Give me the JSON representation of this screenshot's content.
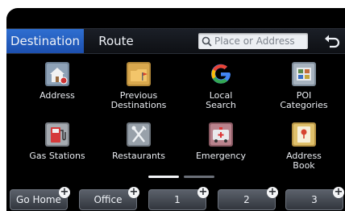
{
  "tabs": [
    {
      "label": "Destination",
      "active": true
    },
    {
      "label": "Route",
      "active": false
    }
  ],
  "search": {
    "placeholder": "Place or Address"
  },
  "grid": [
    {
      "label": "Address",
      "icon": "house-icon"
    },
    {
      "label": "Previous\nDestinations",
      "icon": "folder-flag-icon"
    },
    {
      "label": "Local\nSearch",
      "icon": "google-g-icon"
    },
    {
      "label": "POI\nCategories",
      "icon": "poi-map-icon"
    },
    {
      "label": "Gas Stations",
      "icon": "gas-pump-icon"
    },
    {
      "label": "Restaurants",
      "icon": "fork-knife-icon"
    },
    {
      "label": "Emergency",
      "icon": "ambulance-icon"
    },
    {
      "label": "Address\nBook",
      "icon": "address-book-icon"
    }
  ],
  "pager": {
    "pages": 2,
    "current": 1
  },
  "quick": [
    {
      "label": "Go Home"
    },
    {
      "label": "Office"
    },
    {
      "label": "1"
    },
    {
      "label": "2"
    },
    {
      "label": "3"
    }
  ],
  "colors": {
    "accent": "#2f6fd1",
    "background": "#000000"
  }
}
